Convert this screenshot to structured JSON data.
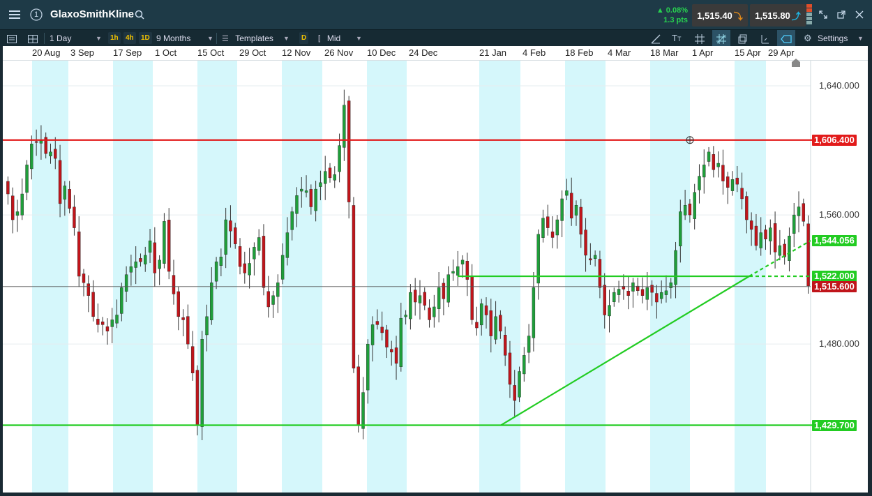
{
  "app": {
    "title": "GlaxoSmithKline",
    "alert_count": "1"
  },
  "quote": {
    "change_pct": "▲ 0.08%",
    "change_pts": "1.3 pts",
    "sell": "1,515.40",
    "buy": "1,515.80"
  },
  "toolbar": {
    "interval": "1 Day",
    "quick_intervals": [
      "1h",
      "4h",
      "1D"
    ],
    "range": "9 Months",
    "templates": "Templates",
    "d_tag": "D",
    "price_type": "Mid",
    "settings": "Settings"
  },
  "chart_data": {
    "type": "candlestick",
    "title": "",
    "x_labels": [
      "20 Aug",
      "3 Sep",
      "17 Sep",
      "1 Oct",
      "15 Oct",
      "29 Oct",
      "12 Nov",
      "26 Nov",
      "10 Dec",
      "24 Dec",
      "21 Jan",
      "4 Feb",
      "18 Feb",
      "4 Mar",
      "18 Mar",
      "1 Apr",
      "15 Apr",
      "29 Apr"
    ],
    "y_ticks": [
      "1,640.000",
      "1,560.000",
      "1,480.000"
    ],
    "ylim": [
      1388,
      1656
    ],
    "horizontal_lines": [
      {
        "label": "1,606.400",
        "value": 1606.4,
        "color": "#e21b1b"
      },
      {
        "label": "1,429.700",
        "value": 1429.7,
        "color": "#22cc22"
      },
      {
        "label": "1,522.000",
        "value": 1522.0,
        "color": "#22cc22"
      },
      {
        "label": "1,515.600",
        "value": 1515.6,
        "color": "#c0151b"
      }
    ],
    "trendline": {
      "label": "1,544.056",
      "value": 1544.056,
      "color": "#22cc22"
    },
    "last_price": "1,515.600",
    "closes": [
      1573,
      1557,
      1562,
      1573,
      1591,
      1604,
      1605,
      1606,
      1598,
      1599,
      1595,
      1567,
      1578,
      1564,
      1552,
      1522,
      1518,
      1510,
      1497,
      1492,
      1492,
      1488,
      1495,
      1498,
      1515,
      1523,
      1528,
      1531,
      1531,
      1535,
      1544,
      1524,
      1532,
      1556,
      1525,
      1511,
      1497,
      1495,
      1480,
      1462,
      1430,
      1483,
      1497,
      1518,
      1531,
      1534,
      1557,
      1550,
      1542,
      1528,
      1524,
      1530,
      1540,
      1546,
      1515,
      1503,
      1510,
      1518,
      1535,
      1549,
      1562,
      1572,
      1576,
      1575,
      1565,
      1576,
      1580,
      1587,
      1583,
      1585,
      1603,
      1628,
      1568,
      1465,
      1430,
      1450,
      1480,
      1492,
      1492,
      1487,
      1478,
      1475,
      1468,
      1496,
      1498,
      1512,
      1506,
      1510,
      1504,
      1495,
      1503,
      1515,
      1508,
      1523,
      1525,
      1528,
      1532,
      1520,
      1495,
      1490,
      1505,
      1498,
      1485,
      1497,
      1488,
      1473,
      1455,
      1445,
      1463,
      1473,
      1485,
      1515,
      1548,
      1558,
      1552,
      1546,
      1557,
      1570,
      1575,
      1558,
      1566,
      1548,
      1535,
      1532,
      1535,
      1515,
      1498,
      1504,
      1512,
      1514,
      1514,
      1510,
      1518,
      1513,
      1510,
      1515,
      1512,
      1506,
      1512,
      1513,
      1518,
      1538,
      1562,
      1566,
      1560,
      1574,
      1584,
      1591,
      1599,
      1588,
      1592,
      1581,
      1577,
      1582,
      1579,
      1570,
      1557,
      1551,
      1541,
      1549,
      1545,
      1552,
      1537,
      1541,
      1534,
      1547,
      1560,
      1565,
      1556,
      1516
    ]
  },
  "colors": {
    "up": "#1f9e3a",
    "down": "#c0151b",
    "band": "#d5f7fb",
    "red_line": "#e21b1b",
    "green_line": "#22cc22",
    "title_bar": "#1e3a47"
  }
}
